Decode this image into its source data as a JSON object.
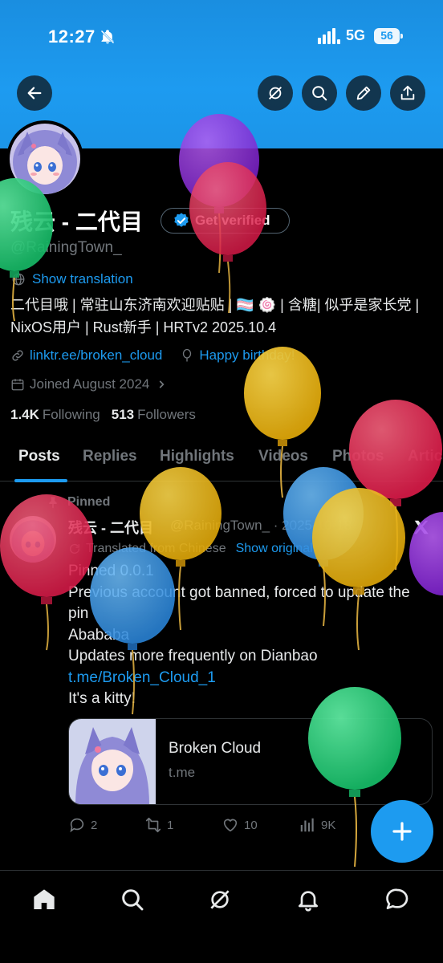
{
  "status_bar": {
    "time": "12:27",
    "network": "5G",
    "battery": "56",
    "icons": [
      "bell-off-icon",
      "signal-icon"
    ]
  },
  "header": {
    "buttons": [
      "back-arrow-icon",
      "grok-icon",
      "search-icon",
      "edit-pencil-icon",
      "share-icon"
    ]
  },
  "profile": {
    "display_name": "残云 - 二代目",
    "verify_label": "Get verified",
    "handle": "@RainingTown_",
    "show_translation": "Show translation",
    "bio": "二代目哦 | 常驻山东济南欢迎贴贴 | 🏳️‍⚧️ 🍥 | 含糖| 似乎是家长党 | NixOS用户 | Rust新手 | HRTv2 2025.10.4",
    "link": "linktr.ee/broken_cloud",
    "birthday": "Happy birthday!",
    "joined": "Joined August 2024",
    "following_count": "1.4K",
    "following_label": "Following",
    "followers_count": "513",
    "followers_label": "Followers"
  },
  "tabs": [
    "Posts",
    "Replies",
    "Highlights",
    "Videos",
    "Photos",
    "Artic"
  ],
  "post": {
    "pinned_label": "Pinned",
    "author_name": "残云 - 二代目",
    "author_handle": "@RainingTown_ · 2025-10-18",
    "translated_label": "Translated from Chinese",
    "show_original": "Show original",
    "lines": {
      "l1": "Pinned 0.0.1",
      "l2": "Previous account got banned, forced to update the pin",
      "l3": "Abababa",
      "l4": "Updates more frequently on Dianbao ",
      "l4_link": "t.me/Broken_Cloud_1",
      "l5": "It's a kitty!"
    },
    "card": {
      "title": "Broken Cloud",
      "domain": "t.me"
    },
    "actions": {
      "replies": "2",
      "reposts": "1",
      "likes": "10",
      "views": "9K"
    }
  },
  "bottom_nav": [
    "home-icon",
    "search-icon",
    "grok-icon",
    "notifications-icon",
    "messages-icon"
  ],
  "colors": {
    "accent": "#1d9bf0",
    "background": "#000000",
    "muted_text": "#71767b",
    "balloons": [
      "#2ecc71",
      "#8e2de2",
      "#e0284f",
      "#e8b820",
      "#4a9de0"
    ]
  }
}
